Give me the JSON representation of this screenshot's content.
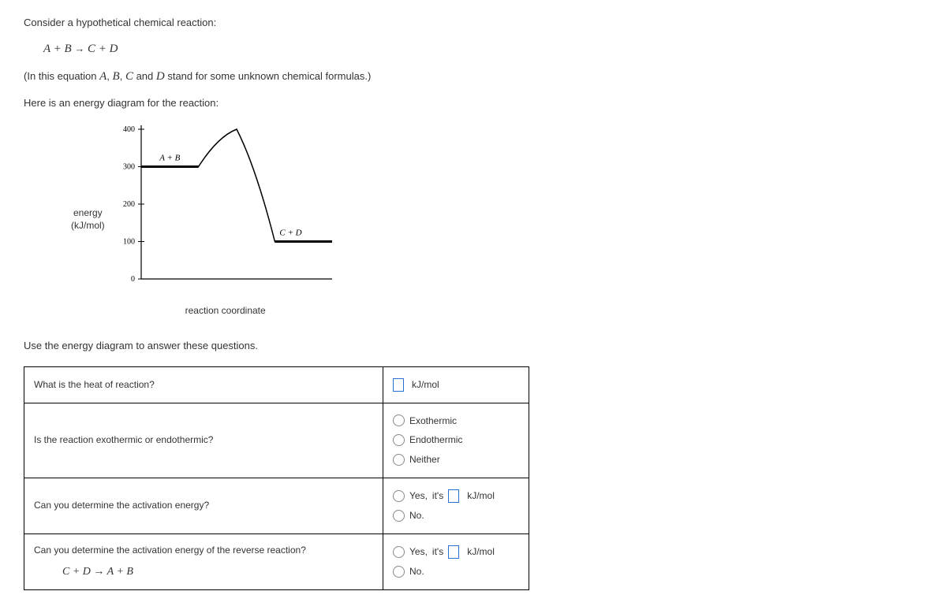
{
  "intro": {
    "p1": "Consider a hypothetical chemical reaction:",
    "equation_lhs": "A + B",
    "equation_rhs": "C + D",
    "arrow": "→",
    "p2_a": "(In this equation ",
    "p2_b": " and ",
    "p2_c": " stand for some unknown chemical formulas.)",
    "A": "A",
    "B": "B",
    "C": "C",
    "D": "D",
    "p3": "Here is an energy diagram for the reaction:",
    "p4": "Use the energy diagram to answer these questions."
  },
  "chart_data": {
    "type": "line",
    "title": "",
    "xlabel": "reaction coordinate",
    "ylabel_line1": "energy",
    "ylabel_line2": "(kJ/mol)",
    "ylim": [
      0,
      400
    ],
    "yticks": [
      0,
      100,
      200,
      300,
      400
    ],
    "reactant_label": "A + B",
    "product_label": "C + D",
    "reactant_energy": 300,
    "product_energy": 100,
    "peak_energy": 400,
    "x": [
      0,
      0.3,
      0.4,
      0.5,
      0.6,
      0.7,
      1.0
    ],
    "y": [
      300,
      300,
      380,
      400,
      300,
      100,
      100
    ]
  },
  "questions": {
    "q1": "What is the heat of reaction?",
    "q1_unit": "kJ/mol",
    "q2": "Is the reaction exothermic or endothermic?",
    "q2_opts": [
      "Exothermic",
      "Endothermic",
      "Neither"
    ],
    "q3": "Can you determine the activation energy?",
    "q3_yes_prefix": "Yes,",
    "q3_yes_its": "it's",
    "q3_unit": "kJ/mol",
    "q3_no": "No.",
    "q4": "Can you determine the activation energy of the reverse reaction?",
    "q4_eq_lhs": "C + D",
    "q4_eq_rhs": "A + B",
    "q4_yes_prefix": "Yes,",
    "q4_yes_its": "it's",
    "q4_unit": "kJ/mol",
    "q4_no": "No."
  }
}
